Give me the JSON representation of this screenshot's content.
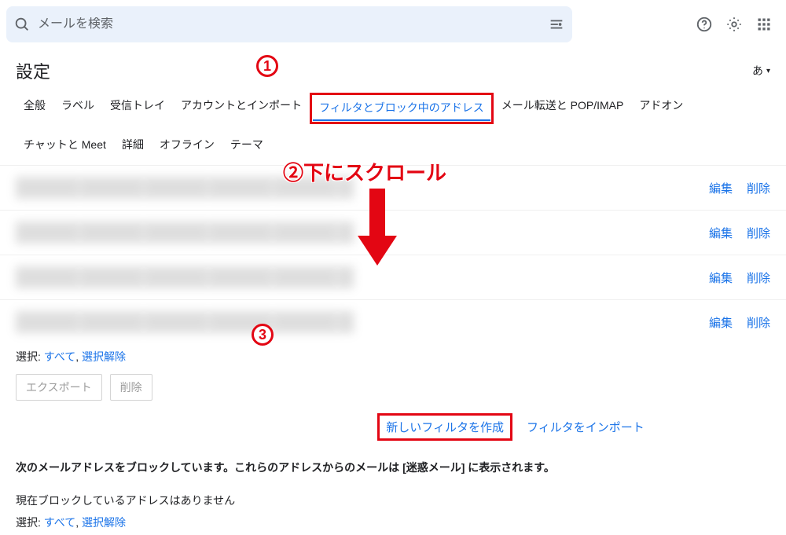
{
  "search": {
    "placeholder": "メールを検索"
  },
  "header": {
    "page_title": "設定",
    "lang_label": "あ"
  },
  "tabs": {
    "items": [
      "全般",
      "ラベル",
      "受信トレイ",
      "アカウントとインポート",
      "フィルタとブロック中のアドレス",
      "メール転送と POP/IMAP",
      "アドオン",
      "チャットと Meet",
      "詳細",
      "オフライン",
      "テーマ"
    ],
    "active_index": 4
  },
  "filters": {
    "rows": [
      {
        "edit": "編集",
        "delete": "削除"
      },
      {
        "edit": "編集",
        "delete": "削除"
      },
      {
        "edit": "編集",
        "delete": "削除"
      },
      {
        "edit": "編集",
        "delete": "削除"
      }
    ]
  },
  "selection": {
    "label": "選択:",
    "all": "すべて",
    "sep": ", ",
    "none": "選択解除"
  },
  "buttons": {
    "export": "エクスポート",
    "delete": "削除"
  },
  "create": {
    "new_filter": "新しいフィルタを作成",
    "import_filter": "フィルタをインポート"
  },
  "block": {
    "text": "次のメールアドレスをブロックしています。これらのアドレスからのメールは [迷惑メール] に表示されます。",
    "none_text": "現在ブロックしているアドレスはありません"
  },
  "selection_bottom": {
    "label": "選択:",
    "all": "すべて",
    "sep": ", ",
    "none": "選択解除"
  },
  "annotations": {
    "step1": "①",
    "step2_prefix": "②",
    "step2_text": "下にスクロール",
    "step3": "③"
  }
}
